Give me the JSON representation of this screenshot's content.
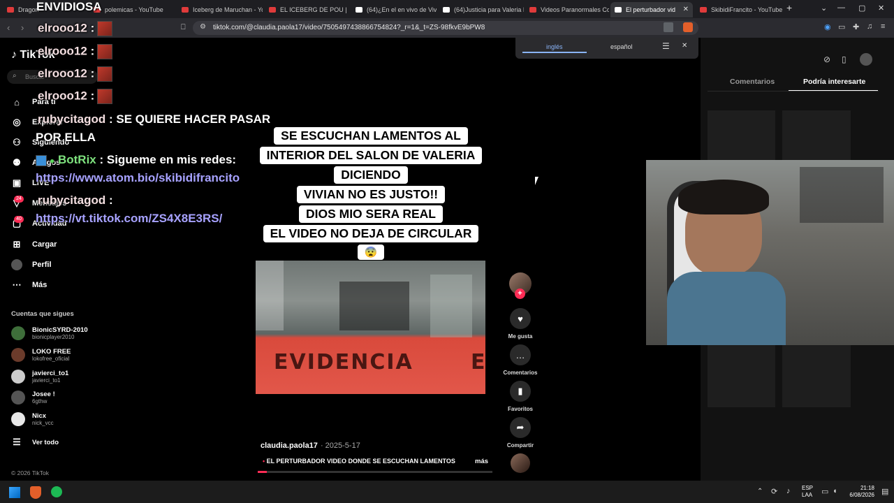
{
  "tabs": [
    {
      "label": "Dragon",
      "favicon_color": "#e03b3b"
    },
    {
      "label": "polemicas - YouTube",
      "favicon_color": "#e03b3b"
    },
    {
      "label": "Iceberg de Maruchan - Yo",
      "favicon_color": "#e03b3b"
    },
    {
      "label": "EL ICEBERG DE POU | CON",
      "favicon_color": "#e03b3b"
    },
    {
      "label": "(64)¿En el en vivo de Vivia",
      "favicon_color": "#ffffff"
    },
    {
      "label": "(64)Justicia para Valeria M",
      "favicon_color": "#ffffff"
    },
    {
      "label": "Videos Paranormales Con",
      "favicon_color": "#e03b3b"
    },
    {
      "label": "El perturbador vid",
      "favicon_color": "#ffffff"
    },
    {
      "label": "SkibidiFrancito - YouTube",
      "favicon_color": "#e03b3b"
    }
  ],
  "stream_title": "ENVIDIOSA",
  "url": "tiktok.com/@claudia.paola17/video/7505497438866754824?_r=1&_t=ZS-98fkvE9bPW8",
  "sidebar": {
    "logo": "TikTok",
    "search_placeholder": "Buscar",
    "nav": [
      {
        "label": "Para ti",
        "icon": "home-icon"
      },
      {
        "label": "Explorar",
        "icon": "compass-icon"
      },
      {
        "label": "Siguiendo",
        "icon": "user-follow-icon"
      },
      {
        "label": "Amigos",
        "icon": "friends-icon"
      },
      {
        "label": "LIVE",
        "icon": "live-icon"
      },
      {
        "label": "Mensajes",
        "icon": "messages-icon",
        "badge": "24"
      },
      {
        "label": "Actividad",
        "icon": "activity-icon",
        "badge": "40"
      },
      {
        "label": "Cargar",
        "icon": "upload-icon"
      },
      {
        "label": "Perfil",
        "icon": "profile-icon"
      },
      {
        "label": "Más",
        "icon": "more-icon"
      }
    ],
    "following_heading": "Cuentas que sigues",
    "following": [
      {
        "name": "BionicSYRD-2010",
        "handle": "bionicplayer2010",
        "avatar_color": "#3e6e3a"
      },
      {
        "name": "LOKO FREE",
        "handle": "lokofree_oficial",
        "avatar_color": "#6b3b2b"
      },
      {
        "name": "javierci_to1",
        "handle": "javierci_to1",
        "avatar_color": "#cccccc"
      },
      {
        "name": "Josee !",
        "handle": "6gthw",
        "avatar_color": "#555555"
      },
      {
        "name": "Nicx",
        "handle": "nick_vcc",
        "avatar_color": "#e8e8e8"
      }
    ],
    "see_all": "Ver todo",
    "footer": "© 2026 TikTok"
  },
  "chat": [
    {
      "user": "elrooo12",
      "text": ""
    },
    {
      "user": "elrooo12",
      "text": ""
    },
    {
      "user": "elrooo12",
      "text": ""
    },
    {
      "user": "elrooo12",
      "text": ""
    },
    {
      "user": "rubycitagod",
      "text": "SE QUIERE HACER PASAR",
      "cont": "POR ELLA"
    },
    {
      "user": "BotRix",
      "text": "Sigueme en mis redes:",
      "cont": "https://www.atom.bio/skibidifrancito"
    },
    {
      "user": "rubycitagod",
      "text": "",
      "cont": "https://vt.tiktok.com/ZS4X8E3RS/"
    }
  ],
  "video": {
    "caption_lines": [
      "SE ESCUCHAN LAMENTOS AL",
      "INTERIOR DEL SALON DE VALERIA",
      "DICIENDO",
      "VIVIAN NO ES JUSTO!!",
      "DIOS MIO SERA REAL",
      "EL VIDEO NO DEJA DE CIRCULAR",
      "😨"
    ],
    "tape_text": "EVIDENCIA",
    "tape_text_edge": "E",
    "author": "claudia.paola17",
    "date": "2025-5-17",
    "description": "EL PERTURBADOR VIDEO DONDE SE ESCUCHAN LAMENTOS",
    "more": "más",
    "progress_fraction": 0.04
  },
  "actions": [
    {
      "label": "Me gusta",
      "icon": "heart-icon"
    },
    {
      "label": "Comentarios",
      "icon": "comment-icon"
    },
    {
      "label": "Favoritos",
      "icon": "bookmark-icon"
    },
    {
      "label": "Compartir",
      "icon": "share-icon"
    }
  ],
  "translate": {
    "lang1": "inglés",
    "lang2": "español"
  },
  "right_panel": {
    "tab1": "Comentarios",
    "tab2": "Podría interesarte"
  },
  "taskbar": {
    "lang": "ESP",
    "layout": "LAA",
    "time": "21:18",
    "date": "6/08/2026"
  },
  "colors": {
    "accent": "#fe2c55",
    "chat_link": "#a7a2ff",
    "bot": "#7ee27e"
  }
}
